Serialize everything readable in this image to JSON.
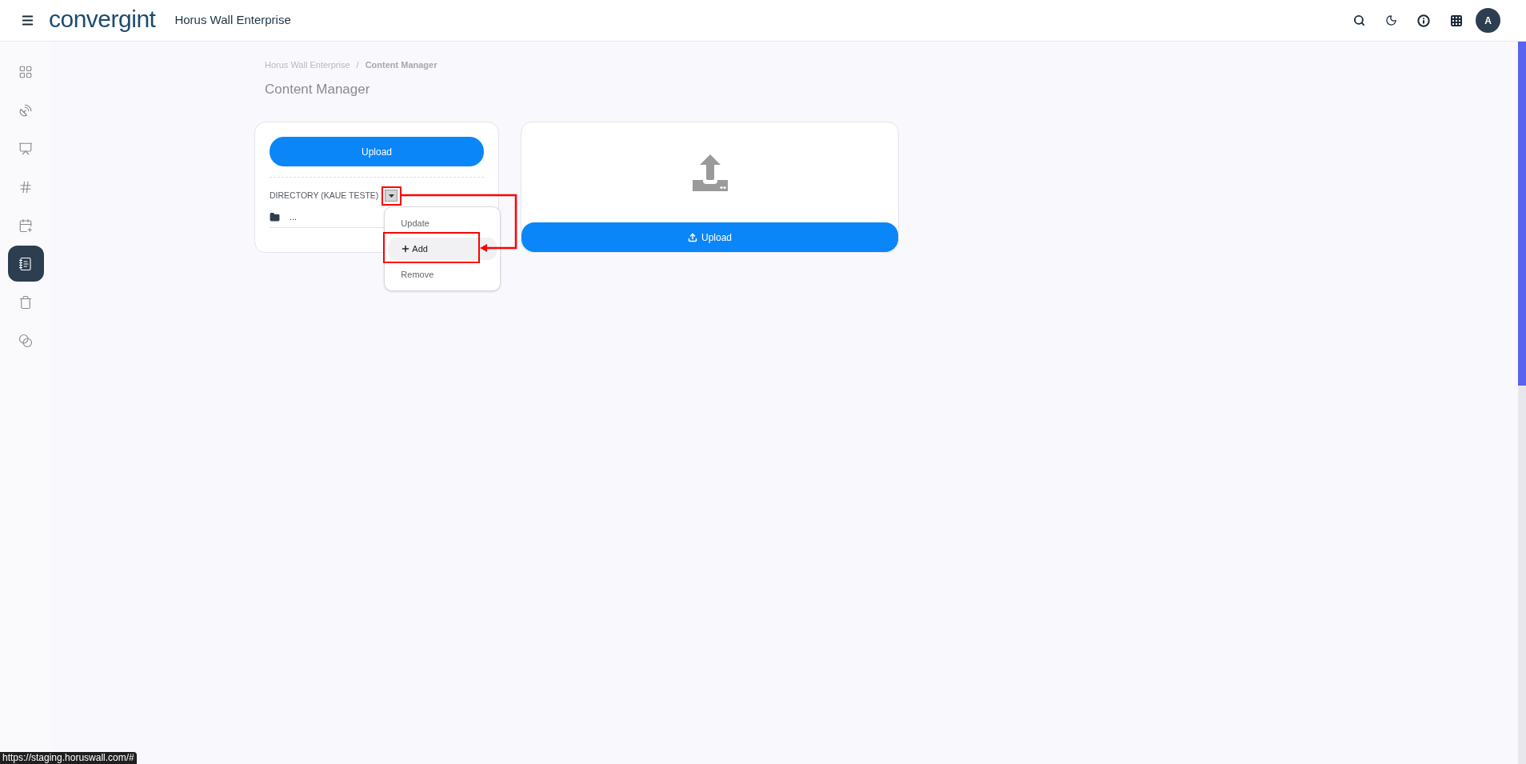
{
  "header": {
    "logo": "convergint",
    "app_title": "Horus Wall Enterprise",
    "avatar": "A"
  },
  "sidebar": {
    "items": [
      {
        "selected": false
      },
      {
        "selected": false
      },
      {
        "selected": false
      },
      {
        "selected": false
      },
      {
        "selected": false
      },
      {
        "selected": true
      },
      {
        "selected": false
      },
      {
        "selected": false
      }
    ]
  },
  "breadcrumb": {
    "items": [
      "Horus Wall Enterprise",
      "Content Manager"
    ],
    "separator": "/"
  },
  "page_title": "Content Manager",
  "directory_card": {
    "upload_button": "Upload",
    "directory_label": "DIRECTORY (KAUE TESTE)",
    "folder_row": "...",
    "menu": {
      "open": true,
      "items": [
        {
          "label": "Update",
          "selected": false,
          "kind": "plain"
        },
        {
          "label": "Add",
          "selected": true,
          "kind": "add"
        },
        {
          "label": "Remove",
          "selected": false,
          "kind": "plain"
        }
      ]
    }
  },
  "upload_card": {
    "upload_button": "Upload"
  },
  "status_url": "https://staging.horuswall.com/#"
}
